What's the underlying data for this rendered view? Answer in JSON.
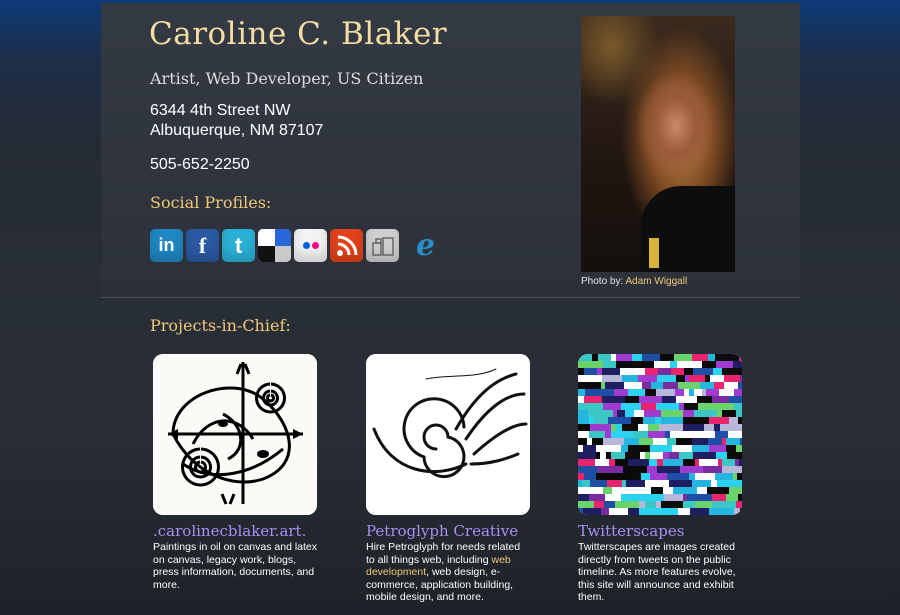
{
  "header": {
    "name": "Caroline C. Blaker",
    "tagline": "Artist, Web Developer, US Citizen",
    "address_line1": "6344 4th Street NW",
    "address_line2": "Albuquerque, NM 87107",
    "phone": "505-652-2250"
  },
  "social": {
    "heading": "Social Profiles:",
    "icons": [
      {
        "name": "linkedin-icon",
        "glyph": "in"
      },
      {
        "name": "facebook-icon",
        "glyph": "f"
      },
      {
        "name": "twitter-icon",
        "glyph": "t"
      },
      {
        "name": "delicious-icon",
        "glyph": ""
      },
      {
        "name": "flickr-icon",
        "glyph": ""
      },
      {
        "name": "rss-icon",
        "glyph": ""
      },
      {
        "name": "myspace-icon",
        "glyph": ""
      },
      {
        "name": "etsy-e-icon",
        "glyph": "e"
      }
    ]
  },
  "photo": {
    "credit_prefix": "Photo by:",
    "credit_name": "Adam Wiggall"
  },
  "projects": {
    "heading": "Projects-in-Chief:",
    "items": [
      {
        "title": ".carolinecblaker.art.",
        "desc": "Paintings in oil on canvas and latex on canvas, legacy work, blogs, press information, documents, and more."
      },
      {
        "title": "Petroglyph Creative",
        "desc_before": "Hire Petroglyph for needs related to all things web, including ",
        "desc_link": "web development",
        "desc_after": ", web design, e-commerce, application building, mobile design, and more."
      },
      {
        "title": "Twitterscapes",
        "desc": "Twitterscapes are images created directly from tweets on the public timeline. As more features evolve, this site will announce and exhibit them."
      }
    ]
  },
  "colors": {
    "accent_gold": "#f0c878",
    "name_gold": "#f5dca3",
    "link_purple": "#a88ef5"
  }
}
